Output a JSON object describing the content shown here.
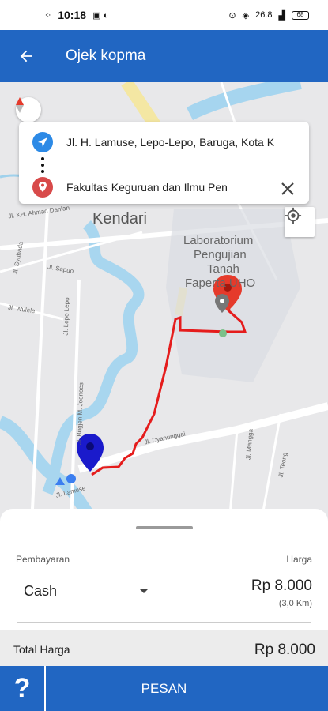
{
  "status_bar": {
    "time": "10:18",
    "network": "26.8",
    "battery": "68"
  },
  "app_bar": {
    "title": "Ojek kopma"
  },
  "route": {
    "origin": "Jl. H. Lamuse, Lepo-Lepo, Baruga, Kota K",
    "destination": "Fakultas Keguruan dan Ilmu Pen"
  },
  "map": {
    "city_label": "Kendari",
    "poi_label_1": "Laboratorium",
    "poi_label_2": "Pengujian",
    "poi_label_3": "Tanah",
    "poi_label_4": "Faperta UHO",
    "street_labels": [
      "Jl. KH. Ahmad Dahlan",
      "Jl. Syuhada",
      "Jl. Sapuo",
      "Jl. Wulele",
      "Jl. Lepo Lepo",
      "Jl. Brigjen M. Joenoes",
      "Jl. Lamuse",
      "Jl. Dyanunggai",
      "Jl. Mangga",
      "Jl. Teong"
    ],
    "route_color": "#e51c1c",
    "origin_pin_color": "#1a1acb",
    "destination_pin_color": "#e53a2b"
  },
  "booking": {
    "payment_label": "Pembayaran",
    "payment_value": "Cash",
    "price_label": "Harga",
    "price_value": "Rp 8.000",
    "distance": "(3,0 Km)",
    "total_label": "Total Harga",
    "total_value": "Rp 8.000"
  },
  "actions": {
    "help_label": "?",
    "order_label": "PESAN"
  },
  "colors": {
    "primary": "#2166c2"
  }
}
